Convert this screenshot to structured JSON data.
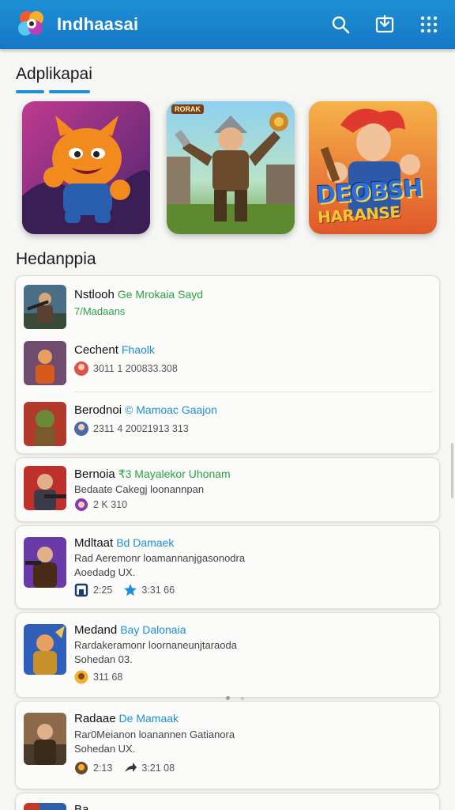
{
  "app": {
    "title": "Indhaasai",
    "icons": [
      "search-icon",
      "download-icon",
      "grid-menu-icon"
    ],
    "accent_color": "#1d8fd6"
  },
  "featured": {
    "title": "Adplikapai",
    "items": [
      {
        "icon": "orange-creature-game-art"
      },
      {
        "icon": "armored-warrior-game-art",
        "badge": "RORAK"
      },
      {
        "icon": "red-hair-hero-game-art",
        "logo_line1": "DEOBSH",
        "logo_line2": "HARANSE"
      }
    ]
  },
  "list": {
    "title": "Hedanppia",
    "cards": [
      {
        "rows": [
          {
            "name": "Nstlooh",
            "tag": "Ge Mrokaia Sayd",
            "sub": "7/Madaans"
          },
          {
            "name": "Cechent",
            "tag": "Fhaolk",
            "meta": "3011 1 200833.308"
          },
          {
            "name": "Berodnoi",
            "tag": "© Mamoac Gaajon",
            "meta": "2311 4 20021913 313"
          }
        ]
      },
      {
        "rows": [
          {
            "name": "Bernoia",
            "tag": "₹3 Mayalekor Uhonam",
            "sub": "Bedaate Cakegj loonannpan",
            "meta": "2 K 310"
          }
        ]
      },
      {
        "rows": [
          {
            "name": "Mdltaat",
            "tag": "Bd Damaek",
            "sub": "Rad Aeremonr loamannanjgasonodra",
            "sub2": "Aoedadg UX.",
            "meta": "2:25",
            "meta2": "3:31 66"
          }
        ]
      },
      {
        "rows": [
          {
            "name": "Medand",
            "tag": "Bay Dalonaia",
            "sub": "Rardakeramonr loornaneunjtaraoda",
            "sub2": "Sohedan 03.",
            "meta": "311 68"
          }
        ]
      },
      {
        "rows": [
          {
            "name": "Radaae",
            "tag": "De Mamaak",
            "sub": "Rar0Meianon loanannen Gatianora",
            "sub2": "Sohedan UX.",
            "meta": "2:13",
            "meta2": "3:21 08"
          }
        ]
      },
      {
        "rows": [
          {
            "name": "Ba"
          }
        ]
      }
    ]
  }
}
